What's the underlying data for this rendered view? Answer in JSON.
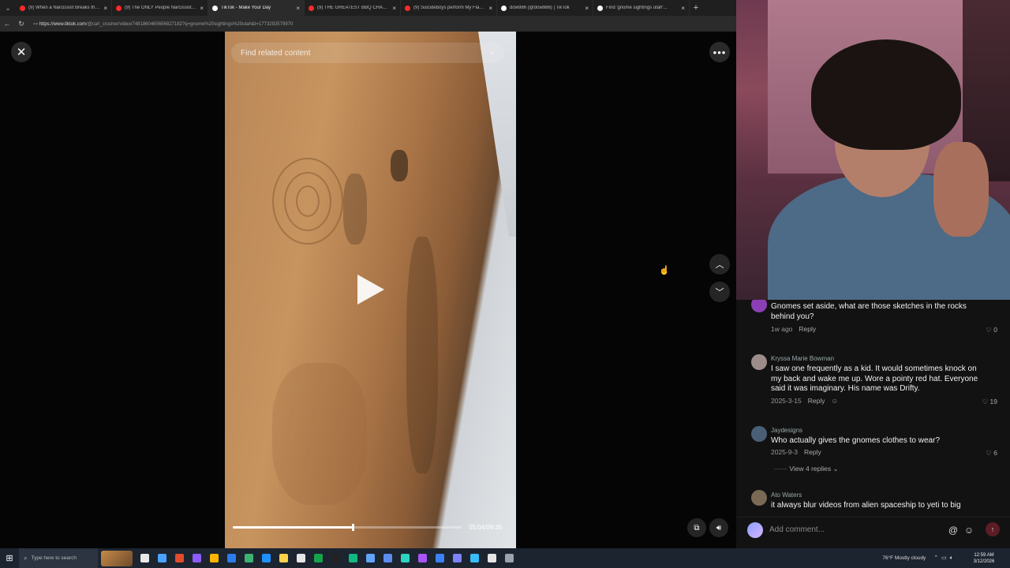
{
  "browser": {
    "tabs": [
      {
        "title": "(9) When a Narcissist Breaks the ...",
        "color": "#ff2a2a",
        "active": false
      },
      {
        "title": "(9) The ONLY People Narcissists Fe...",
        "color": "#ff2a2a",
        "active": false
      },
      {
        "title": "TikTok - Make Your Day",
        "color": "#ffffff",
        "active": true
      },
      {
        "title": "(9) THE GREATEST BBQ CHALLENGE...",
        "color": "#ff2a2a",
        "active": false
      },
      {
        "title": "(9) Suicideboys perform My Flaws...",
        "color": "#ff2a2a",
        "active": false
      },
      {
        "title": "dow986 (@dow986) | TikTok",
        "color": "#ffffff",
        "active": false
      },
      {
        "title": "Find 'gnome sightings utah'...",
        "color": "#ffffff",
        "active": false
      }
    ],
    "new_tab_glyph": "+",
    "url_host": "https://www.tiktok.com",
    "url_path": "/@carl_crusher/video/7481860465656827182?q=gnome%20sightings%20utah&t=1773292579970"
  },
  "player": {
    "search_placeholder": "Find related content",
    "timecode": "05:04/09:35",
    "progress": 0.52,
    "close_glyph": "✕",
    "more_glyph": "•••",
    "up_glyph": "︿",
    "down_glyph": "﹀"
  },
  "comments": [
    {
      "name": "",
      "text": "Gnomes set aside, what are those sketches in the rocks behind you?",
      "date": "1w ago",
      "reply": "Reply",
      "likes": "0"
    },
    {
      "name": "Kryssa Marie Bowman",
      "text": "I saw one frequently as a kid. It would sometimes knock on my back and wake me up. Wore a pointy red hat. Everyone said it was imaginary. His name was Drifty.",
      "date": "2025-3-15",
      "reply": "Reply",
      "likes": "19"
    },
    {
      "name": "Jaydesigns",
      "text": "Who actually gives the gnomes clothes to wear?",
      "date": "2025-9-3",
      "reply": "Reply",
      "likes": "6",
      "view_replies": "View 4 replies"
    },
    {
      "name": "Ato Waters",
      "text": "it always blur videos from alien spaceship to yeti to big",
      "date": "",
      "reply": "",
      "likes": ""
    }
  ],
  "comment_box": {
    "placeholder": "Add comment...",
    "mention_glyph": "@",
    "emoji_glyph": "☺",
    "send_glyph": "↑"
  },
  "taskbar": {
    "search_placeholder": "Type here to search",
    "weather": "76°F  Mostly cloudy",
    "time": "12:59 AM",
    "date": "3/12/2026",
    "app_colors": [
      "#e8e8e8",
      "#4aa3ff",
      "#e34b2b",
      "#8c5cff",
      "#ffb400",
      "#2b7de9",
      "#3cb371",
      "#1e90ff",
      "#ffd24a",
      "#e5e5e5",
      "#17a34a",
      "#222",
      "#10b981",
      "#60a5fa",
      "#5b8def",
      "#2dd4bf",
      "#a855f7",
      "#3b82f6",
      "#7c83fd",
      "#38bdf8",
      "#e5e5e5",
      "#9ca3af"
    ]
  }
}
